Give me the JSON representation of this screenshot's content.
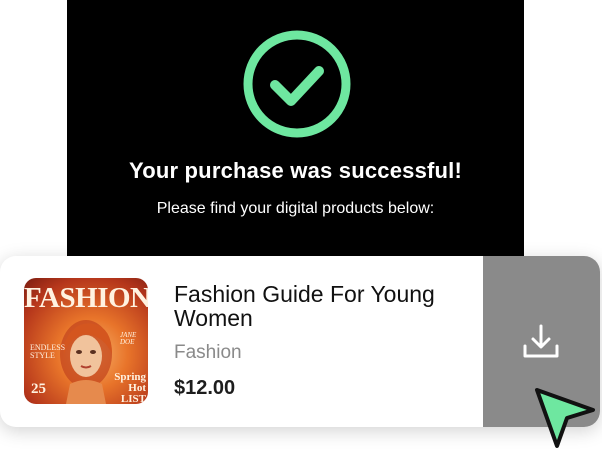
{
  "success": {
    "title": "Your purchase was successful!",
    "subtitle": "Please find your digital products below:",
    "icon": "check-circle-icon",
    "accent_color": "#6ee7a0"
  },
  "product": {
    "title": "Fashion Guide For Young Women",
    "category": "Fashion",
    "price": "$12.00",
    "cover": {
      "masthead": "FASHION",
      "headline_left": "ENDLESS STYLE",
      "headline_right": "JANE DOE",
      "feature": "Spring Hot LIST",
      "number": "25"
    },
    "download_icon": "download-icon",
    "download_panel_color": "#8a8a8a"
  },
  "cursor": {
    "icon": "cursor-arrow-icon",
    "color": "#6ee7a0"
  }
}
